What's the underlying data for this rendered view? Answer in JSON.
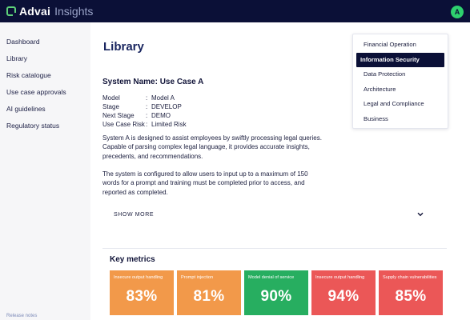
{
  "header": {
    "brand": "Advai",
    "product": "Insights",
    "avatar_initial": "A"
  },
  "sidebar": {
    "items": [
      {
        "label": "Dashboard"
      },
      {
        "label": "Library"
      },
      {
        "label": "Risk catalogue"
      },
      {
        "label": "Use case approvals"
      },
      {
        "label": "AI guidelines"
      },
      {
        "label": "Regulatory status"
      }
    ],
    "release_notes": "Release notes"
  },
  "main": {
    "title": "Library",
    "system": {
      "name": "System Name: Use Case A",
      "fields": [
        {
          "key": "Model",
          "value": "Model A"
        },
        {
          "key": "Stage",
          "value": "DEVELOP"
        },
        {
          "key": "Next Stage",
          "value": "DEMO"
        },
        {
          "key": "Use Case Risk",
          "value": "Limited Risk"
        }
      ],
      "separator": ":",
      "description_1": "System A is designed to assist employees by swiftly processing legal queries. Capable of parsing complex legal language, it provides accurate insights, precedents, and recommendations.",
      "description_2": "The system is configured to allow users to input up to a maximum of 150 words for a prompt and training must be completed prior to access, and reported as completed."
    },
    "show_more": "SHOW MORE",
    "metrics": {
      "title": "Key metrics",
      "cards": [
        {
          "label": "Insecure output handling",
          "value": "83%",
          "color": "#f2994a"
        },
        {
          "label": "Prompt injection",
          "value": "81%",
          "color": "#f2994a"
        },
        {
          "label": "Model denial of service",
          "value": "90%",
          "color": "#27ae60"
        },
        {
          "label": "Insecure output handling",
          "value": "94%",
          "color": "#eb5757"
        },
        {
          "label": "Supply chain vulnerabilities",
          "value": "85%",
          "color": "#eb5757"
        }
      ]
    }
  },
  "category_menu": {
    "items": [
      {
        "label": "Financial Operation"
      },
      {
        "label": "Information Security"
      },
      {
        "label": "Data Protection"
      },
      {
        "label": "Architecture"
      },
      {
        "label": "Legal and Compliance"
      },
      {
        "label": "Business"
      }
    ],
    "selected": "Information Security"
  }
}
